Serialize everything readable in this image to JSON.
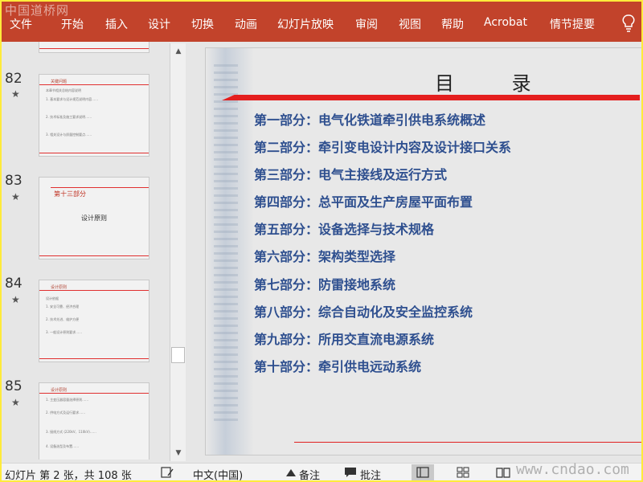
{
  "watermark_top": "中国道桥网",
  "watermark_bottom": "www.cndao.com",
  "ribbon": {
    "tabs": [
      "文件",
      "开始",
      "插入",
      "设计",
      "切换",
      "动画",
      "幻灯片放映",
      "审阅",
      "视图",
      "帮助",
      "Acrobat",
      "情节提要"
    ]
  },
  "thumbnails": [
    {
      "number": "82",
      "title": "关键问题",
      "lines": [
        "本章节相关总结内容说明",
        "1. 基本要求与设计规范说明内容……",
        "2. 技术标准及施工要求说明……",
        "3. 相关设计与质量控制要点……"
      ]
    },
    {
      "number": "83",
      "head": "第十三部分",
      "center": "设计原则"
    },
    {
      "number": "84",
      "title": "设计原则",
      "lines": [
        "设计依据",
        "1. 安全可靠、经济合理",
        "2. 技术先进、维护方便",
        "3. 一般设计原则要求……"
      ]
    },
    {
      "number": "85",
      "title": "设计原则",
      "lines": [
        "1. 主变压器容量选择原则……",
        "2. 供电方式及运行要求……",
        "3. 接线方式 (220kV、110kV)……",
        "4. 设备选型及布置……"
      ]
    }
  ],
  "slide": {
    "title": "目 录",
    "items": [
      "第一部分：电气化铁道牵引供电系统概述",
      "第二部分：牵引变电设计内容及设计接口关系",
      "第三部分：电气主接线及运行方式",
      "第四部分：总平面及生产房屋平面布置",
      "第五部分：设备选择与技术规格",
      "第六部分：架构类型选择",
      "第七部分：防雷接地系统",
      "第八部分：综合自动化及安全监控系统",
      "第九部分：所用交直流电源系统",
      "第十部分：牵引供电远动系统"
    ]
  },
  "status": {
    "slide_info": "幻灯片 第 2 张，共 108 张",
    "language": "中文(中国)",
    "notes": "备注",
    "comments": "批注"
  },
  "icons": {
    "lightbulb": "lightbulb-icon",
    "star": "star-icon",
    "notes": "notes-icon",
    "comments": "comment-icon"
  }
}
